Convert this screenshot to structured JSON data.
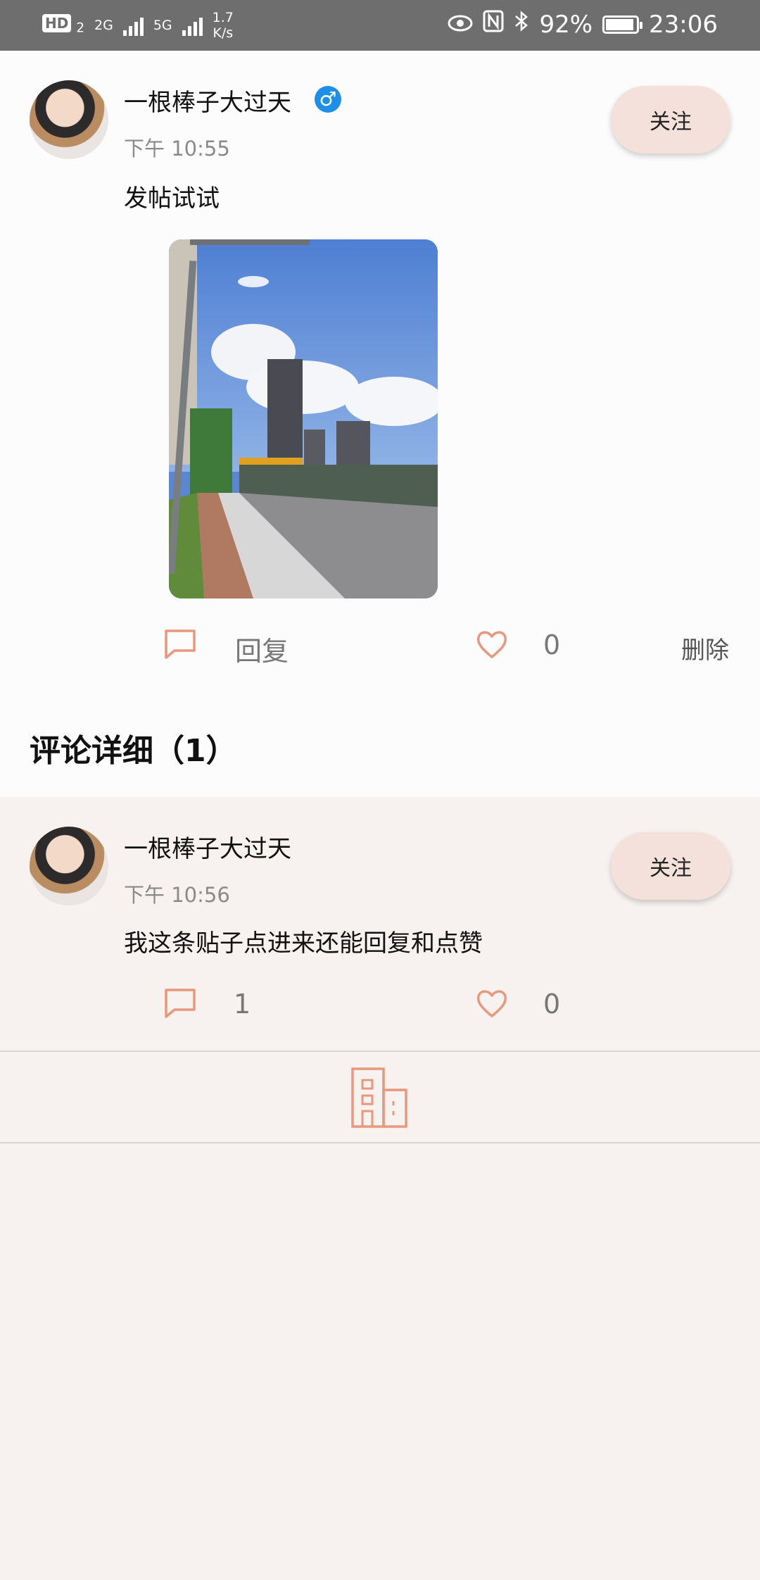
{
  "status_bar": {
    "hd": "HD",
    "hd_sub": "2",
    "net1": "2G",
    "net2": "5G",
    "speed": "1.7",
    "speed_unit": "K/s",
    "battery": "92%",
    "time": "23:06",
    "battery_level": 0.92
  },
  "post": {
    "username": "一根棒子大过天",
    "gender_symbol": "♂",
    "time": "下午 10:55",
    "text": "发帖试试",
    "follow_label": "关注",
    "reply_label": "回复",
    "like_count": "0",
    "delete_label": "删除"
  },
  "comments_section": {
    "title": "评论详细（1）"
  },
  "comment": {
    "username": "一根棒子大过天",
    "time": "下午 10:56",
    "text": "我这条贴子点进来还能回复和点赞",
    "follow_label": "关注",
    "reply_count": "1",
    "like_count": "0"
  },
  "colors": {
    "accent": "#e8987d",
    "follow_bg": "#f5e1db",
    "status_bar": "#6e6e6e",
    "gender_blue": "#1e8fe6"
  },
  "icons": {
    "reply": "chat-bubble-icon",
    "like": "heart-icon",
    "bottom": "building-icon"
  }
}
